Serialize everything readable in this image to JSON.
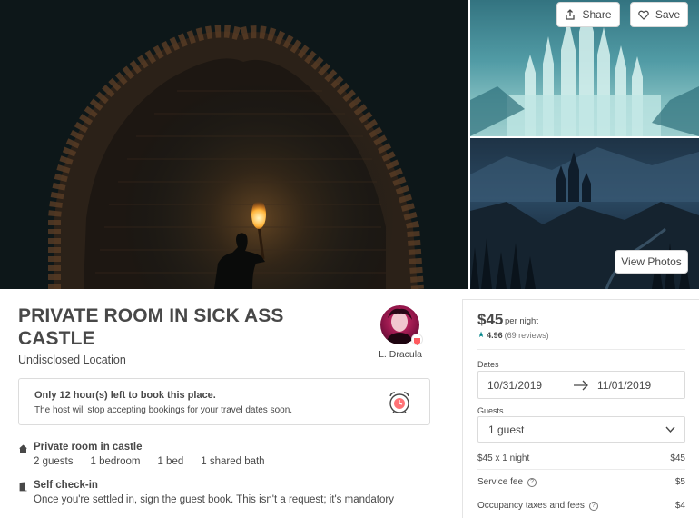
{
  "gallery": {
    "share_label": "Share",
    "save_label": "Save",
    "view_photos_label": "View Photos"
  },
  "listing": {
    "title": "PRIVATE ROOM IN SICK ASS CASTLE",
    "location": "Undisclosed Location",
    "host_name": "L. Dracula"
  },
  "notice": {
    "title": "Only 12 hour(s) left to book this place.",
    "subtitle": "The host will stop accepting bookings for your travel dates soon.",
    "icon": "alarm-clock-icon"
  },
  "features": [
    {
      "icon": "home-icon",
      "title": "Private room in castle",
      "details": [
        "2 guests",
        "1 bedroom",
        "1 bed",
        "1 shared bath"
      ]
    },
    {
      "icon": "door-icon",
      "title": "Self check-in",
      "detail": "Once you're settled in, sign the guest book. This isn't a request; it's mandatory"
    }
  ],
  "booking": {
    "price": "$45",
    "per_night": "per night",
    "rating": "4.96",
    "reviews": "(69 reviews)",
    "dates_label": "Dates",
    "check_in": "10/31/2019",
    "check_out": "11/01/2019",
    "guests_label": "Guests",
    "guests_value": "1 guest",
    "fees": [
      {
        "label": "$45 x 1 night",
        "amount": "$45",
        "info": false
      },
      {
        "label": "Service fee",
        "amount": "$5",
        "info": true
      },
      {
        "label": "Occupancy taxes and fees",
        "amount": "$4",
        "info": true
      }
    ],
    "info_glyph": "?"
  },
  "colors": {
    "text": "#484848",
    "accent": "#008489",
    "border": "#dcdcdc"
  }
}
